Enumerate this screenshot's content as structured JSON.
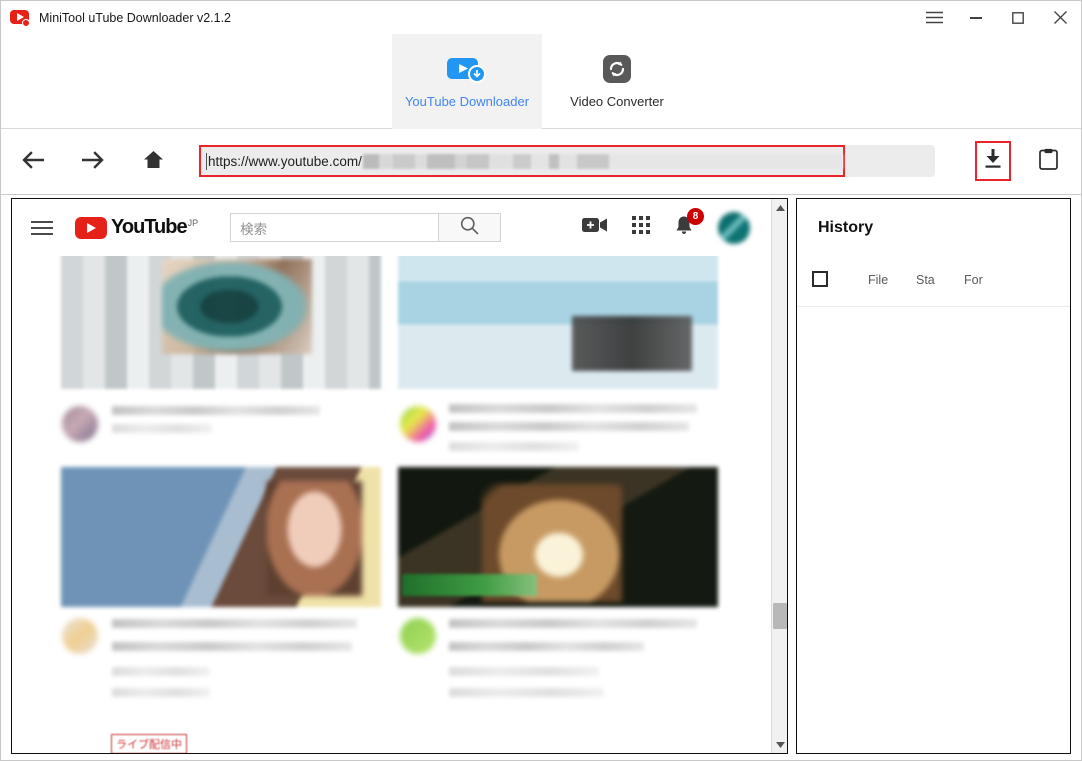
{
  "window": {
    "title": "MiniTool uTube Downloader v2.1.2",
    "icon": "app-youtube-download-icon",
    "controls": [
      {
        "name": "menu-button",
        "glyph": "hamburger"
      },
      {
        "name": "minimize-button",
        "glyph": "minimize"
      },
      {
        "name": "maximize-button",
        "glyph": "maximize"
      },
      {
        "name": "close-button",
        "glyph": "close"
      }
    ]
  },
  "tabs": [
    {
      "label": "YouTube Downloader",
      "icon": "video-download-icon",
      "active": true
    },
    {
      "label": "Video Converter",
      "icon": "convert-refresh-icon",
      "active": false
    }
  ],
  "accent": {
    "tab_active": "#4285f4",
    "highlight_red": "#e8252a",
    "youtube_red": "#e62117"
  },
  "navbar": {
    "back_icon": "arrow-left-icon",
    "forward_icon": "arrow-right-icon",
    "home_icon": "home-icon",
    "url": "https://www.youtube.com/",
    "url_placeholder": "https://www.youtube.com/",
    "url_redacted_note": "blurred",
    "download_icon": "download-icon",
    "paste_icon": "clipboard-icon"
  },
  "browser": {
    "menu_icon": "hamburger-icon",
    "logo": {
      "wordmark": "YouTube",
      "country": "JP"
    },
    "search": {
      "placeholder": "検索",
      "value": "",
      "icon": "search-icon"
    },
    "actions": [
      {
        "name": "create-video-icon",
        "label": ""
      },
      {
        "name": "apps-grid-icon",
        "label": ""
      },
      {
        "name": "notifications-bell-icon",
        "badge": "8"
      },
      {
        "name": "avatar",
        "label": ""
      }
    ],
    "live_badge": "ライブ配信中",
    "scrollbar": {
      "up_icon": "chevron-up-icon",
      "down_icon": "chevron-down-icon"
    }
  },
  "history": {
    "title": "History",
    "select_all_checked": false,
    "columns": [
      "File",
      "Sta",
      "For"
    ],
    "rows": []
  }
}
